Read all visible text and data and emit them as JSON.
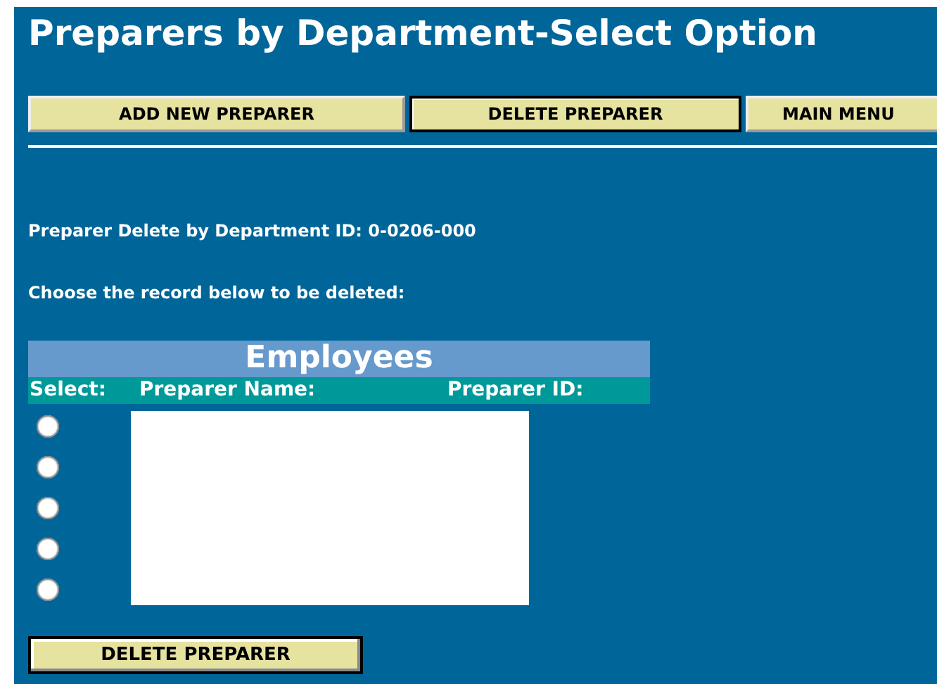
{
  "title": "Preparers by Department-Select Option",
  "menu_buttons": [
    {
      "label": "ADD NEW PREPARER",
      "focused": false
    },
    {
      "label": "DELETE PREPARER",
      "focused": true
    },
    {
      "label": "MAIN MENU",
      "focused": false
    }
  ],
  "department_line": "Preparer Delete by Department ID: 0-0206-000",
  "instruction": "Choose the record below to be deleted:",
  "table": {
    "title": "Employees",
    "columns": [
      "Select:",
      "Preparer Name:",
      "Preparer ID:"
    ],
    "rows": [
      {
        "selected": false
      },
      {
        "selected": false
      },
      {
        "selected": false
      },
      {
        "selected": false
      },
      {
        "selected": false
      }
    ]
  },
  "submit_button": "DELETE PREPARER"
}
